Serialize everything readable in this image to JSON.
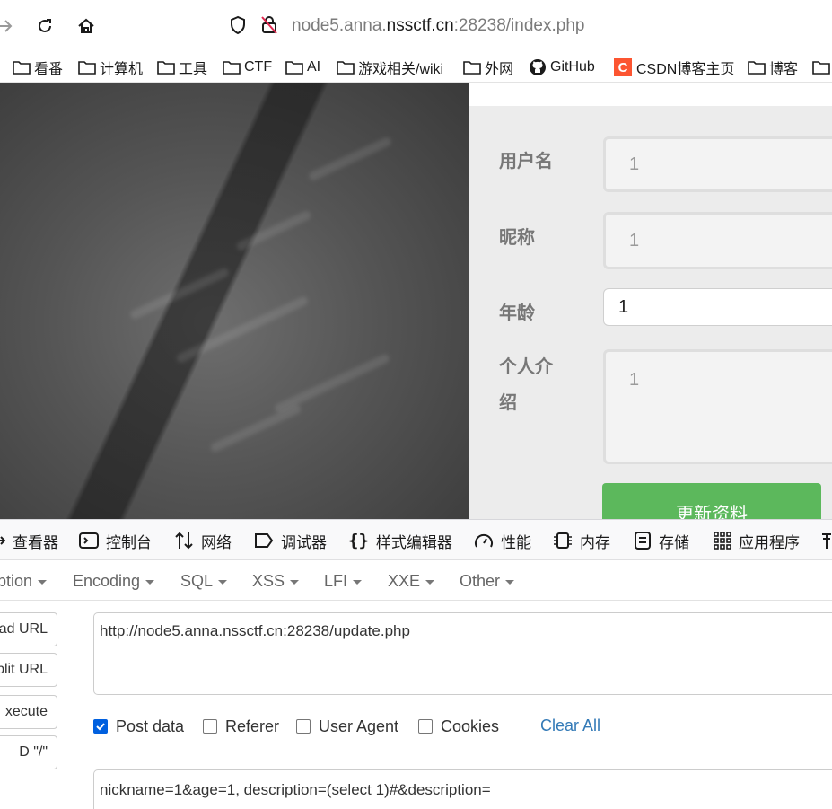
{
  "browser": {
    "url_prefix": "node5.anna.",
    "url_host": "nssctf.cn",
    "url_suffix": ":28238/index.php"
  },
  "bookmarks": [
    {
      "label": "看番",
      "icon": "folder-icon"
    },
    {
      "label": "计算机",
      "icon": "folder-icon"
    },
    {
      "label": "工具",
      "icon": "folder-icon"
    },
    {
      "label": "CTF",
      "icon": "folder-icon"
    },
    {
      "label": "AI",
      "icon": "folder-icon"
    },
    {
      "label": "游戏相关/wiki",
      "icon": "folder-icon"
    },
    {
      "label": "外网",
      "icon": "folder-icon"
    },
    {
      "label": "GitHub",
      "icon": "github-icon"
    },
    {
      "label": "CSDN博客主页",
      "icon": "csdn-icon"
    },
    {
      "label": "博客",
      "icon": "folder-icon"
    }
  ],
  "csdn_logo_letter": "C",
  "form": {
    "username_label": "用户名",
    "username_value": "1",
    "nickname_label": "昵称",
    "nickname_value": "1",
    "age_label": "年龄",
    "age_value": "1",
    "bio_label_line1": "个人介",
    "bio_label_line2": "绍",
    "bio_value": "1",
    "submit_label": "更新资料"
  },
  "devtools": {
    "tabs": [
      {
        "label": "查看器",
        "icon": "inspector-icon"
      },
      {
        "label": "控制台",
        "icon": "console-icon"
      },
      {
        "label": "网络",
        "icon": "network-icon"
      },
      {
        "label": "调试器",
        "icon": "debugger-icon"
      },
      {
        "label": "样式编辑器",
        "icon": "style-editor-icon"
      },
      {
        "label": "性能",
        "icon": "performance-icon"
      },
      {
        "label": "内存",
        "icon": "memory-icon"
      },
      {
        "label": "存储",
        "icon": "storage-icon"
      },
      {
        "label": "应用程序",
        "icon": "application-icon"
      }
    ]
  },
  "hackbar": {
    "menu": [
      "ption",
      "Encoding",
      "SQL",
      "XSS",
      "LFI",
      "XXE",
      "Other"
    ],
    "side_buttons": [
      "ad URL",
      "plit URL",
      "xecute",
      "D \"/\""
    ],
    "url_value": "http://node5.anna.nssctf.cn:28238/update.php",
    "options": [
      {
        "label": "Post data",
        "checked": true
      },
      {
        "label": "Referer",
        "checked": false
      },
      {
        "label": "User Agent",
        "checked": false
      },
      {
        "label": "Cookies",
        "checked": false
      }
    ],
    "clear_all": "Clear All",
    "post_value": "nickname=1&age=1, description=(select 1)#&description="
  },
  "colors": {
    "submit_button": "#5cb85c",
    "link": "#337ab7",
    "checkbox_checked": "#0060df",
    "csdn_badge": "#fc5531"
  }
}
